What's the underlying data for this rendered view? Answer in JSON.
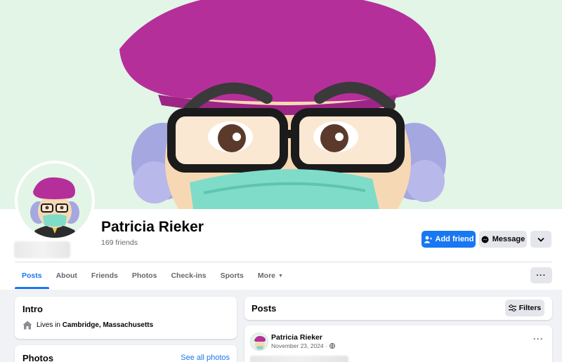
{
  "profile": {
    "name": "Patricia Rieker",
    "friends": "169 friends"
  },
  "actions": {
    "add_friend": "Add friend",
    "message": "Message"
  },
  "tabs": [
    {
      "label": "Posts"
    },
    {
      "label": "About"
    },
    {
      "label": "Friends"
    },
    {
      "label": "Photos"
    },
    {
      "label": "Check-ins"
    },
    {
      "label": "Sports"
    },
    {
      "label": "More"
    }
  ],
  "intro": {
    "title": "Intro",
    "lives_prefix": "Lives in ",
    "city": "Cambridge, Massachusetts"
  },
  "photos": {
    "title": "Photos",
    "see_all": "See all photos"
  },
  "posts": {
    "title": "Posts",
    "filters": "Filters",
    "author": "Patricia Rieker",
    "date": "November 23, 2024 ·"
  },
  "colors": {
    "accent": "#1877f2",
    "cover_bg": "#e3f5e6",
    "beret": "#b52f9a"
  }
}
